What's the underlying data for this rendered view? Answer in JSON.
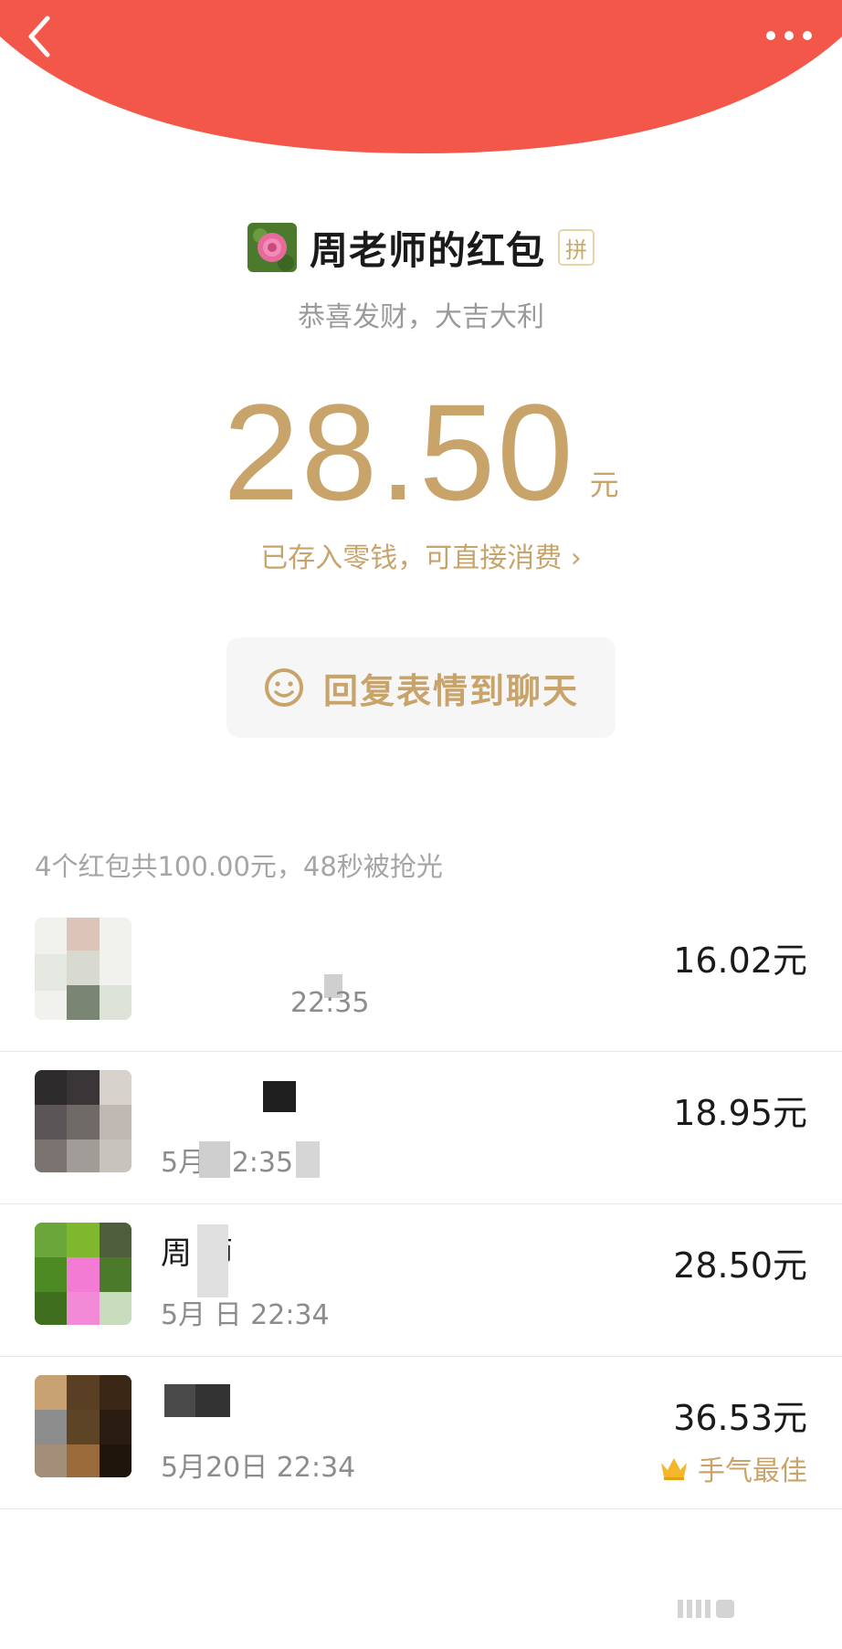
{
  "colors": {
    "banner": "#f2574a",
    "gold": "#c8a46b",
    "gray_text": "#9a9a9a"
  },
  "nav": {
    "back_icon": "chevron-left-icon",
    "more_icon": "more-dots-icon"
  },
  "sender": {
    "name": "周老师的红包",
    "badge": "拼",
    "blessing": "恭喜发财，大吉大利"
  },
  "amount": {
    "value": "28.50",
    "unit": "元",
    "saved_text": "已存入零钱，可直接消费",
    "saved_arrow": "›"
  },
  "reply": {
    "label": "回复表情到聊天",
    "icon": "smiley-icon"
  },
  "summary": "4个红包共100.00元，48秒被抢光",
  "recipients": [
    {
      "name": "",
      "time": "22:35",
      "amount": "16.02元",
      "best": ""
    },
    {
      "name": "",
      "time": "5月     22:35",
      "amount": "18.95元",
      "best": ""
    },
    {
      "name": "周    师",
      "time": "5月    日  22:34",
      "amount": "28.50元",
      "best": ""
    },
    {
      "name": "",
      "time": "5月20日  22:34",
      "amount": "36.53元",
      "best": "手气最佳"
    }
  ]
}
